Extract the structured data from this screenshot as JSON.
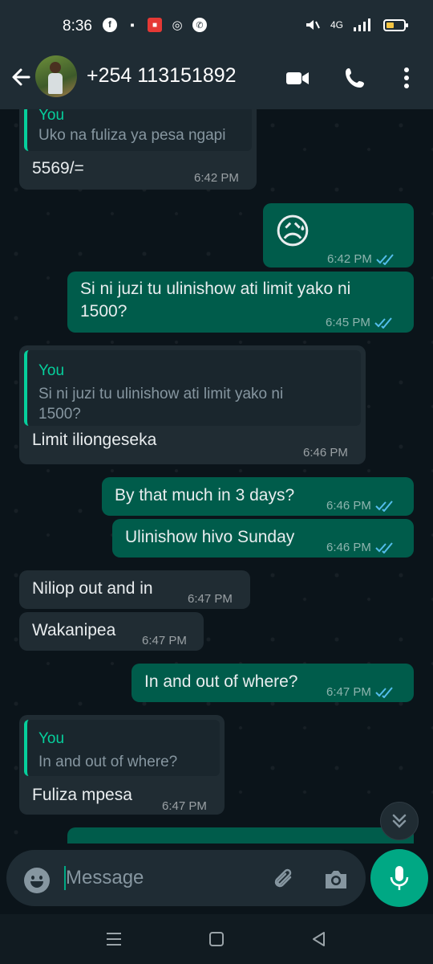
{
  "status_bar": {
    "time": "8:36",
    "network": "4G",
    "left_icons": [
      "facebook-icon",
      "grid-icon",
      "app-notification-icon",
      "instagram-icon",
      "whatsapp-icon"
    ],
    "right_icons": [
      "mute-icon",
      "signal-icon",
      "battery-icon"
    ],
    "battery_level": 0.35,
    "battery_color": "#f5c542"
  },
  "header": {
    "contact_name": "+254 113151892",
    "icons": [
      "back-arrow-icon",
      "avatar",
      "video-call-icon",
      "voice-call-icon",
      "more-options-icon"
    ]
  },
  "colors": {
    "background": "#0b141a",
    "header": "#1f2c34",
    "incoming_bubble": "#202c33",
    "outgoing_bubble": "#005c4b",
    "accent": "#00a884",
    "quote_author": "#06cf9c",
    "read_ticks": "#53bdeb"
  },
  "messages": [
    {
      "dir": "in",
      "quote_author": "You",
      "quote_text": "Uko na fuliza ya pesa ngapi",
      "text": "5569/=",
      "time": "6:42 PM"
    },
    {
      "dir": "out",
      "text": "😥",
      "time": "6:42 PM",
      "status": "read"
    },
    {
      "dir": "out",
      "text": "Si ni juzi tu ulinishow ati limit yako ni 1500?",
      "time": "6:45 PM",
      "status": "read"
    },
    {
      "dir": "in",
      "quote_author": "You",
      "quote_text": "Si ni juzi tu ulinishow ati limit yako ni 1500?",
      "text": "Limit iliongeseka",
      "time": "6:46 PM"
    },
    {
      "dir": "out",
      "text": "By that much in 3 days?",
      "time": "6:46 PM",
      "status": "read"
    },
    {
      "dir": "out",
      "text": "Ulinishow hivo Sunday",
      "time": "6:46 PM",
      "status": "read"
    },
    {
      "dir": "in",
      "text": "Niliop out and in",
      "time": "6:47 PM"
    },
    {
      "dir": "in",
      "text": "Wakanipea",
      "time": "6:47 PM"
    },
    {
      "dir": "out",
      "text": "In and out of where?",
      "time": "6:47 PM",
      "status": "read"
    },
    {
      "dir": "in",
      "quote_author": "You",
      "quote_text": "In and out of where?",
      "text": "Fuliza mpesa",
      "time": "6:47 PM"
    }
  ],
  "input": {
    "placeholder": "Message",
    "icons": [
      "emoji-icon",
      "attach-icon",
      "camera-icon",
      "mic-icon"
    ]
  },
  "nav_bar": {
    "icons": [
      "menu-icon",
      "home-icon",
      "back-icon"
    ]
  }
}
